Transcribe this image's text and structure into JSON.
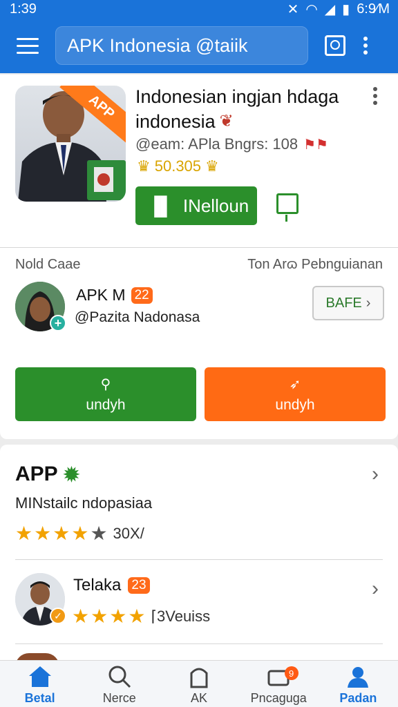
{
  "status_bar": {
    "time": "1:39",
    "right_time": "6:9∕M"
  },
  "app_bar": {
    "search_text": "APK Indonesia @taiik"
  },
  "app": {
    "title_line1": "Indonesian ingjan hdaga",
    "title_line2": "indonesia",
    "ribbon": "APP",
    "meta": "@eam: APla Bngrs: 108",
    "rating": "50.305",
    "install_label": "INelloun"
  },
  "developer_section": {
    "left_label": "Nold Caae",
    "right_label": "Ton Arɷ Pebnguianan",
    "name": "APK M",
    "badge": "22",
    "handle": "@Pazita Nadonasa",
    "safe_label": "BAFE",
    "download_green": "undyh",
    "download_orange": "undyh"
  },
  "app_card": {
    "heading": "APP",
    "subtitle": "MINstailc ndopasiaa",
    "rating_stars": 4,
    "rating_count": "30X/"
  },
  "review": {
    "name": "Telaka",
    "badge": "23",
    "rating_stars": 4,
    "reviews_text": "⌈3Veuiss"
  },
  "bottom_nav": [
    {
      "label": "Betal",
      "icon": "home-icon",
      "active": true
    },
    {
      "label": "Nerce",
      "icon": "search-icon",
      "active": false
    },
    {
      "label": "AK",
      "icon": "apps-icon",
      "active": false
    },
    {
      "label": "Pncaguga",
      "icon": "updates-icon",
      "active": false,
      "badge": "9"
    },
    {
      "label": "Padan",
      "icon": "profile-icon",
      "active": true
    }
  ],
  "colors": {
    "primary": "#1a73d9",
    "green": "#2b8f2b",
    "orange": "#ff6a14",
    "star": "#f2a200"
  }
}
